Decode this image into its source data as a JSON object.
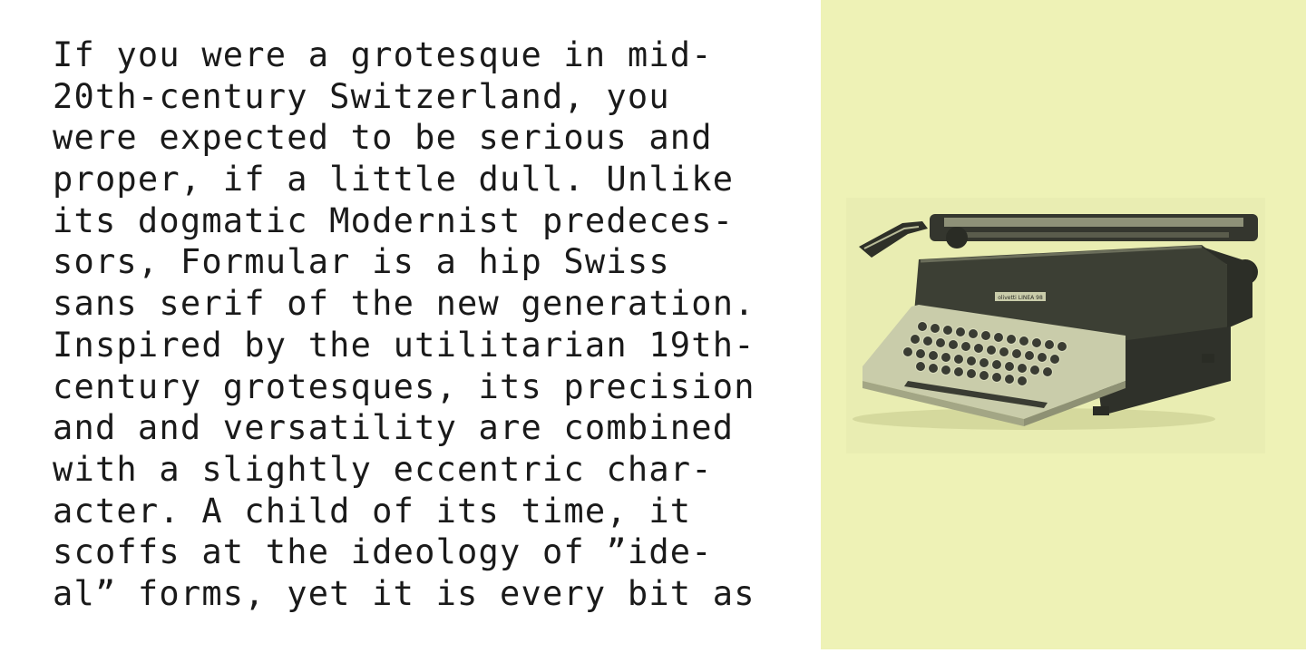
{
  "body_text": {
    "lines": [
      "If you were a grotesque in mid-",
      "20th-century Switzerland, you",
      "were expected to be serious and",
      "proper, if a little dull. Unlike",
      "its dogmatic Modernist predeces-",
      "sors, Formular is a hip Swiss",
      "sans serif of the new generation.",
      "Inspired by the utilitarian 19th-",
      "century grotesques, its precision",
      "and and versatility are combined",
      "with a slightly eccentric char-",
      "acter. A child of its time, it",
      "scoffs at the ideology of ”ide-",
      "al” forms, yet it is every bit as"
    ]
  },
  "image_panel": {
    "background_color": "#eef2b6",
    "subject": "typewriter-illustration",
    "brand_plate_text": "olivetti LINEA 98"
  },
  "colors": {
    "text": "#1a1a1a",
    "page_background": "#ffffff",
    "typewriter_body": "#3c3f34",
    "typewriter_light": "#c9ccaa"
  }
}
